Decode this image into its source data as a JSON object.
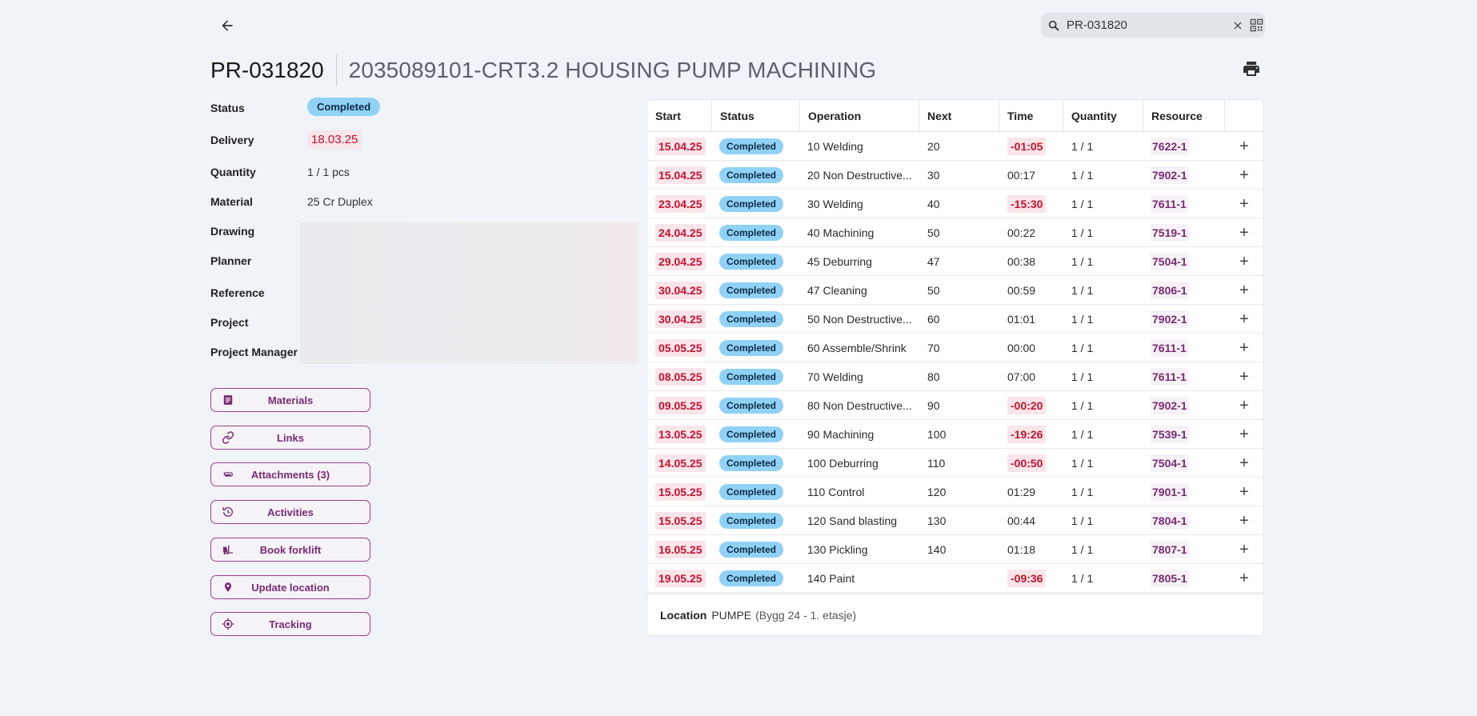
{
  "search": {
    "value": "PR-031820"
  },
  "header": {
    "order_id": "PR-031820",
    "description": "2035089101-CRT3.2 HOUSING PUMP MACHINING"
  },
  "info": {
    "status_label": "Status",
    "status_value": "Completed",
    "delivery_label": "Delivery",
    "delivery_value": "18.03.25",
    "quantity_label": "Quantity",
    "quantity_value": "1 / 1 pcs",
    "material_label": "Material",
    "material_value": "25 Cr Duplex",
    "drawing_label": "Drawing",
    "planner_label": "Planner",
    "reference_label": "Reference",
    "project_label": "Project",
    "project_manager_label": "Project Manager"
  },
  "actions": [
    {
      "label": "Materials",
      "icon": "list-icon"
    },
    {
      "label": "Links",
      "icon": "link-icon"
    },
    {
      "label": "Attachments (3)",
      "icon": "paperclip-icon"
    },
    {
      "label": "Activities",
      "icon": "history-icon"
    },
    {
      "label": "Book forklift",
      "icon": "forklift-icon"
    },
    {
      "label": "Update location",
      "icon": "location-pin-icon"
    },
    {
      "label": "Tracking",
      "icon": "crosshair-icon"
    }
  ],
  "table": {
    "headers": [
      "Start",
      "Status",
      "Operation",
      "Next",
      "Time",
      "Quantity",
      "Resource"
    ],
    "rows": [
      {
        "start": "15.04.25",
        "status": "Completed",
        "operation": "10 Welding",
        "next": "20",
        "time": "-01:05",
        "time_neg": true,
        "quantity": "1 / 1",
        "resource": "7622-1"
      },
      {
        "start": "15.04.25",
        "status": "Completed",
        "operation": "20 Non Destructive...",
        "next": "30",
        "time": "00:17",
        "time_neg": false,
        "quantity": "1 / 1",
        "resource": "7902-1"
      },
      {
        "start": "23.04.25",
        "status": "Completed",
        "operation": "30 Welding",
        "next": "40",
        "time": "-15:30",
        "time_neg": true,
        "quantity": "1 / 1",
        "resource": "7611-1"
      },
      {
        "start": "24.04.25",
        "status": "Completed",
        "operation": "40 Machining",
        "next": "50",
        "time": "00:22",
        "time_neg": false,
        "quantity": "1 / 1",
        "resource": "7519-1"
      },
      {
        "start": "29.04.25",
        "status": "Completed",
        "operation": "45 Deburring",
        "next": "47",
        "time": "00:38",
        "time_neg": false,
        "quantity": "1 / 1",
        "resource": "7504-1"
      },
      {
        "start": "30.04.25",
        "status": "Completed",
        "operation": "47 Cleaning",
        "next": "50",
        "time": "00:59",
        "time_neg": false,
        "quantity": "1 / 1",
        "resource": "7806-1"
      },
      {
        "start": "30.04.25",
        "status": "Completed",
        "operation": "50 Non Destructive...",
        "next": "60",
        "time": "01:01",
        "time_neg": false,
        "quantity": "1 / 1",
        "resource": "7902-1"
      },
      {
        "start": "05.05.25",
        "status": "Completed",
        "operation": "60 Assemble/Shrink",
        "next": "70",
        "time": "00:00",
        "time_neg": false,
        "quantity": "1 / 1",
        "resource": "7611-1"
      },
      {
        "start": "08.05.25",
        "status": "Completed",
        "operation": "70 Welding",
        "next": "80",
        "time": "07:00",
        "time_neg": false,
        "quantity": "1 / 1",
        "resource": "7611-1"
      },
      {
        "start": "09.05.25",
        "status": "Completed",
        "operation": "80 Non Destructive...",
        "next": "90",
        "time": "-00:20",
        "time_neg": true,
        "quantity": "1 / 1",
        "resource": "7902-1"
      },
      {
        "start": "13.05.25",
        "status": "Completed",
        "operation": "90 Machining",
        "next": "100",
        "time": "-19:26",
        "time_neg": true,
        "quantity": "1 / 1",
        "resource": "7539-1"
      },
      {
        "start": "14.05.25",
        "status": "Completed",
        "operation": "100 Deburring",
        "next": "110",
        "time": "-00:50",
        "time_neg": true,
        "quantity": "1 / 1",
        "resource": "7504-1"
      },
      {
        "start": "15.05.25",
        "status": "Completed",
        "operation": "110 Control",
        "next": "120",
        "time": "01:29",
        "time_neg": false,
        "quantity": "1 / 1",
        "resource": "7901-1"
      },
      {
        "start": "15.05.25",
        "status": "Completed",
        "operation": "120 Sand blasting",
        "next": "130",
        "time": "00:44",
        "time_neg": false,
        "quantity": "1 / 1",
        "resource": "7804-1"
      },
      {
        "start": "16.05.25",
        "status": "Completed",
        "operation": "130 Pickling",
        "next": "140",
        "time": "01:18",
        "time_neg": false,
        "quantity": "1 / 1",
        "resource": "7807-1"
      },
      {
        "start": "19.05.25",
        "status": "Completed",
        "operation": "140 Paint",
        "next": "",
        "time": "-09:36",
        "time_neg": true,
        "quantity": "1 / 1",
        "resource": "7805-1"
      }
    ]
  },
  "location": {
    "label": "Location",
    "value": "PUMPE",
    "detail": "(Bygg 24 - 1. etasje)"
  },
  "colors": {
    "accent": "#7a2a74",
    "status_badge": "#90d2f5",
    "overdue": "#c8102e",
    "background": "#f0f3f7"
  }
}
